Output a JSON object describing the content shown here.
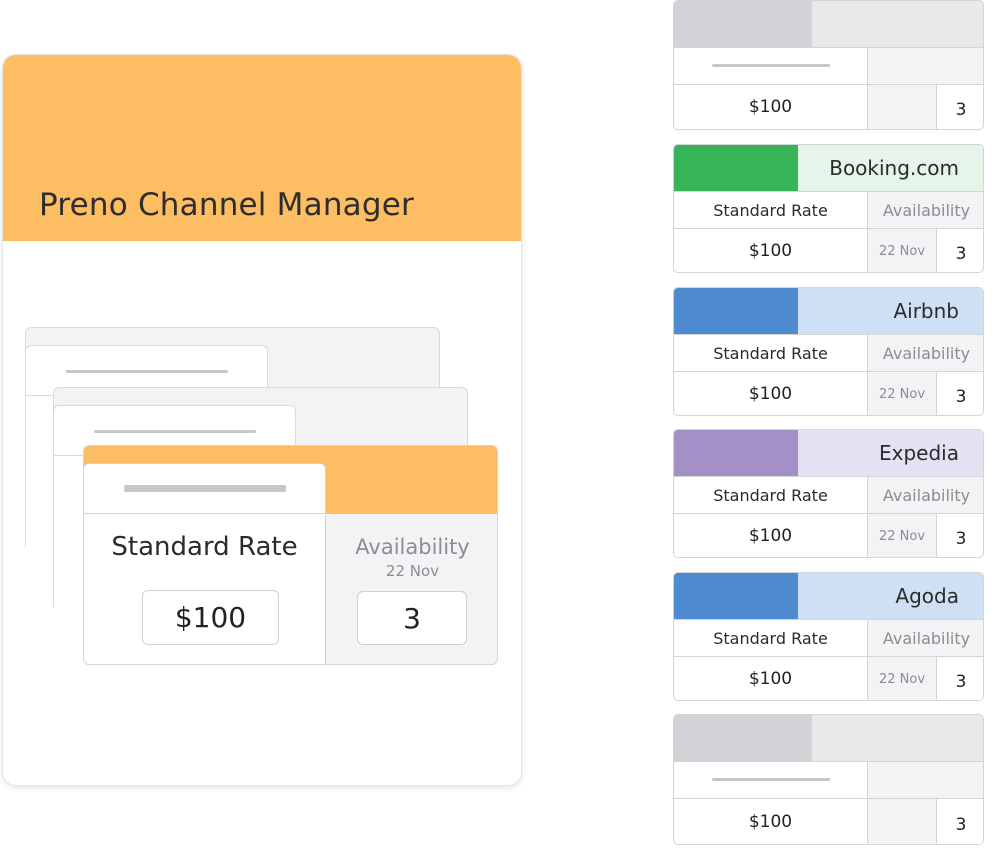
{
  "app": {
    "title": "Preno Channel Manager"
  },
  "colors": {
    "accent_orange": "#fdbe63",
    "booking_green": "#37b358",
    "booking_tint": "#e6f5ea",
    "airbnb_blue": "#4e8bd0",
    "airbnb_tint": "#cfe0f4",
    "expedia_purple": "#a390c7",
    "expedia_tint": "#e6e0f3",
    "agoda_blue": "#4e8bd0",
    "agoda_tint": "#cfe0f4",
    "placeholder_gray": "#d3d3d7",
    "placeholder_tint": "#e9e9ec"
  },
  "rate_editor": {
    "rate_label": "Standard Rate",
    "rate_value": "$100",
    "availability_label": "Availability",
    "availability_date": "22 Nov",
    "availability_value": "3"
  },
  "channels": [
    {
      "name": "",
      "placeholder": true,
      "price": "$100",
      "qty": "3"
    },
    {
      "name": "Booking.com",
      "rate_label": "Standard Rate",
      "availability_label": "Availability",
      "price": "$100",
      "date": "22 Nov",
      "qty": "3"
    },
    {
      "name": "Airbnb",
      "rate_label": "Standard Rate",
      "availability_label": "Availability",
      "price": "$100",
      "date": "22 Nov",
      "qty": "3"
    },
    {
      "name": "Expedia",
      "rate_label": "Standard Rate",
      "availability_label": "Availability",
      "price": "$100",
      "date": "22 Nov",
      "qty": "3"
    },
    {
      "name": "Agoda",
      "rate_label": "Standard Rate",
      "availability_label": "Availability",
      "price": "$100",
      "date": "22 Nov",
      "qty": "3"
    },
    {
      "name": "",
      "placeholder": true,
      "price": "$100",
      "qty": "3"
    }
  ]
}
